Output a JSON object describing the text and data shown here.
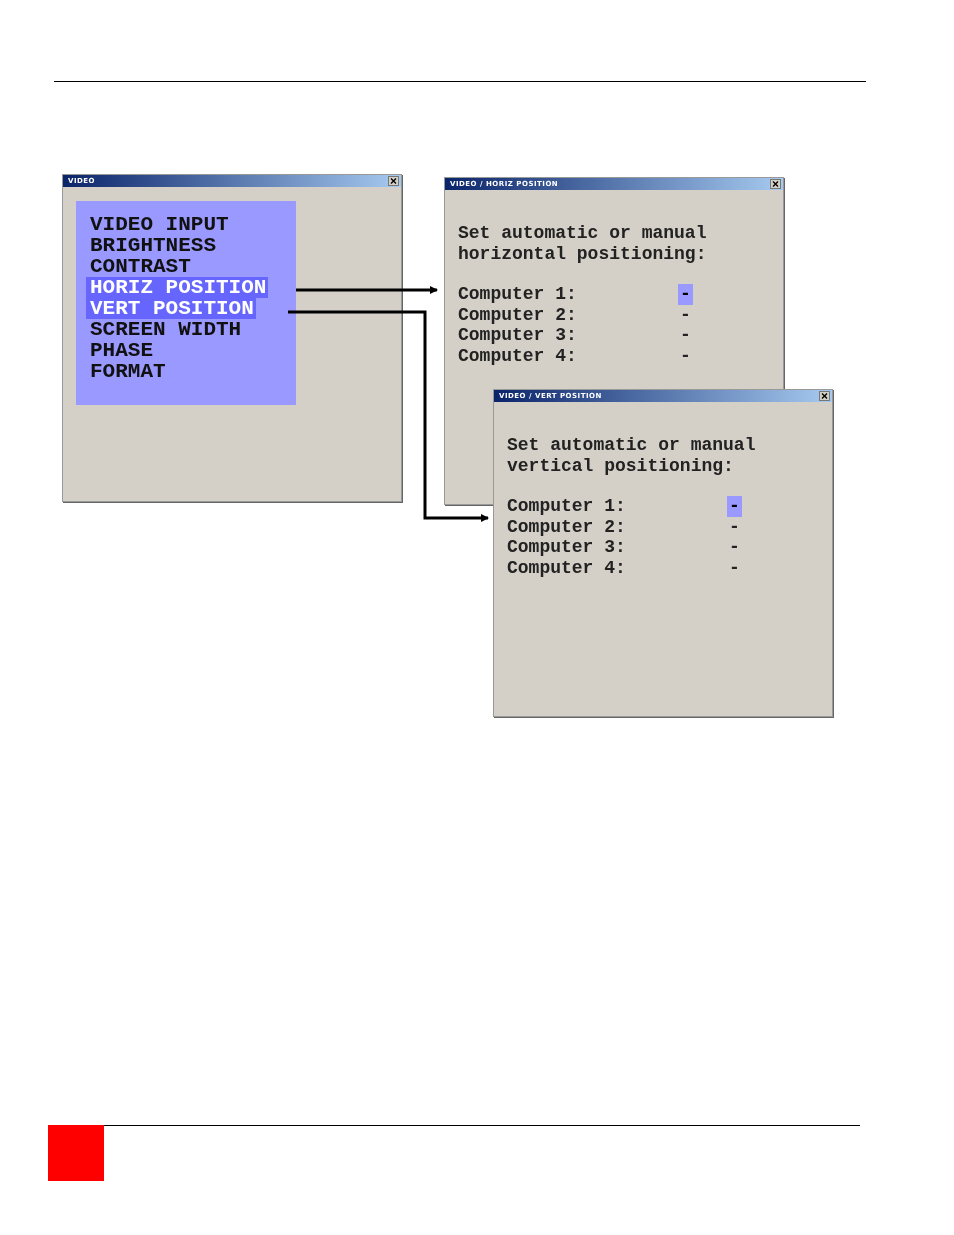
{
  "menu_window": {
    "title": "VIDEO",
    "items": [
      {
        "label": "VIDEO INPUT",
        "selected": false
      },
      {
        "label": "BRIGHTNESS",
        "selected": false
      },
      {
        "label": "CONTRAST",
        "selected": false
      },
      {
        "label": "HORIZ POSITION",
        "selected": true
      },
      {
        "label": "VERT POSITION",
        "selected": true
      },
      {
        "label": "SCREEN WIDTH",
        "selected": false
      },
      {
        "label": "PHASE",
        "selected": false
      },
      {
        "label": "FORMAT",
        "selected": false
      }
    ]
  },
  "dialogs": [
    {
      "title": "VIDEO / HORIZ POSITION",
      "prompt": [
        "Set automatic or manual",
        "horizontal positioning:"
      ],
      "rows": [
        {
          "label": "Computer 1:",
          "value": "-",
          "selected": true
        },
        {
          "label": "Computer 2:",
          "value": "-",
          "selected": false
        },
        {
          "label": "Computer 3:",
          "value": "-",
          "selected": false
        },
        {
          "label": "Computer 4:",
          "value": "-",
          "selected": false
        }
      ]
    },
    {
      "title": "VIDEO / VERT POSITION",
      "prompt": [
        "Set automatic or manual",
        "vertical positioning:"
      ],
      "rows": [
        {
          "label": "Computer 1:",
          "value": "-",
          "selected": true
        },
        {
          "label": "Computer 2:",
          "value": "-",
          "selected": false
        },
        {
          "label": "Computer 3:",
          "value": "-",
          "selected": false
        },
        {
          "label": "Computer 4:",
          "value": "-",
          "selected": false
        }
      ]
    }
  ]
}
